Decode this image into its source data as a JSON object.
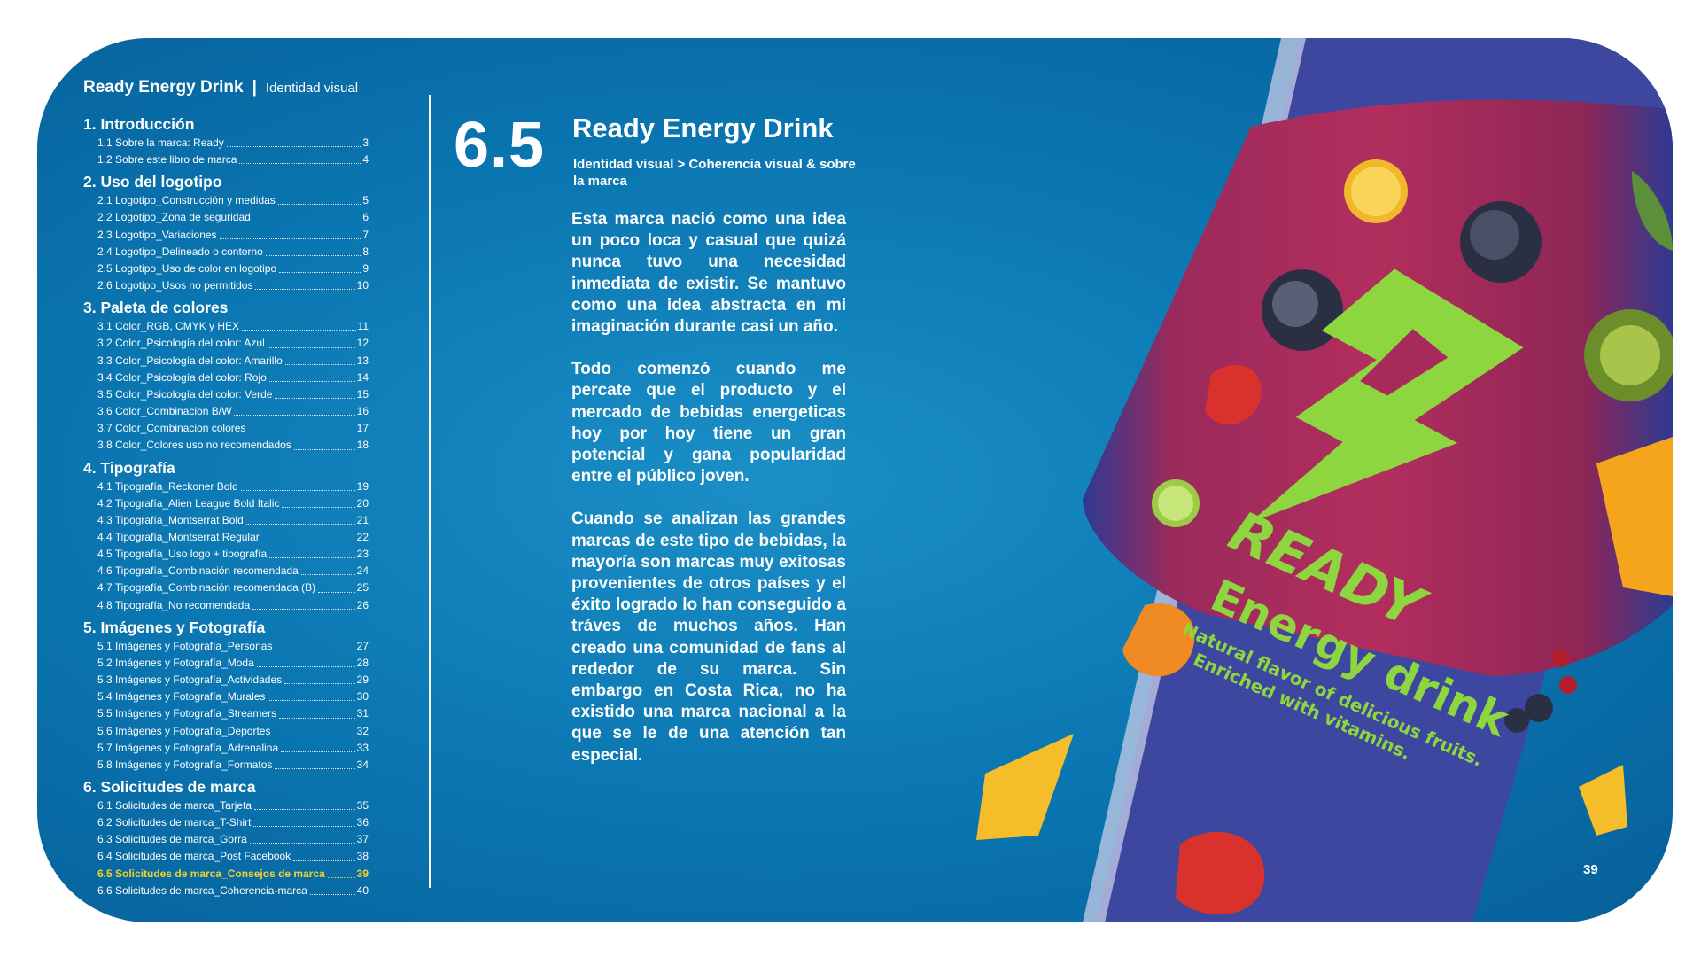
{
  "header": {
    "brand": "Ready Energy Drink",
    "separator": "|",
    "subtitle": "Identidad visual"
  },
  "toc": [
    {
      "title": "1. Introducción",
      "entries": [
        {
          "label": "1.1  Sobre la marca: Ready",
          "page": "3"
        },
        {
          "label": "1.2  Sobre este libro de marca",
          "page": "4"
        }
      ]
    },
    {
      "title": "2. Uso del logotipo",
      "entries": [
        {
          "label": "2.1  Logotipo_Construcción y medidas",
          "page": "5"
        },
        {
          "label": "2.2 Logotipo_Zona de seguridad",
          "page": "6"
        },
        {
          "label": "2.3 Logotipo_Variaciones",
          "page": "7"
        },
        {
          "label": "2.4  Logotipo_Delineado o contorno",
          "page": "8"
        },
        {
          "label": "2.5 Logotipo_Uso de color en logotipo",
          "page": "9"
        },
        {
          "label": "2.6 Logotipo_Usos no permitidos",
          "page": "10"
        }
      ]
    },
    {
      "title": "3. Paleta de colores",
      "entries": [
        {
          "label": "3.1  Color_RGB, CMYK y HEX",
          "page": "11"
        },
        {
          "label": "3.2 Color_Psicología del color: Azul",
          "page": "12"
        },
        {
          "label": "3.3 Color_Psicología del color: Amarillo",
          "page": "13"
        },
        {
          "label": "3.4 Color_Psicología del color: Rojo",
          "page": "14"
        },
        {
          "label": "3.5 Color_Psicología del color: Verde",
          "page": "15"
        },
        {
          "label": "3.6 Color_Combinacion B/W",
          "page": "16"
        },
        {
          "label": "3.7 Color_Combinacion colores",
          "page": "17"
        },
        {
          "label": "3.8 Color_Colores uso no recomendados",
          "page": "18"
        }
      ]
    },
    {
      "title": "4. Tipografía",
      "entries": [
        {
          "label": "4.1  Tipografía_Reckoner Bold",
          "page": "19"
        },
        {
          "label": "4.2 Tipografía_Alien League Bold Italic",
          "page": "20"
        },
        {
          "label": "4.3 Tipografía_Montserrat Bold",
          "page": "21"
        },
        {
          "label": "4.4 Tipografía_Montserrat Regular",
          "page": "22"
        },
        {
          "label": "4.5 Tipografía_Uso logo + tipografía",
          "page": "23"
        },
        {
          "label": "4.6 Tipografía_Combinación recomendada",
          "page": "24"
        },
        {
          "label": "4.7 Tipografía_Combinación recomendada (B)",
          "page": "25"
        },
        {
          "label": "4.8 Tipografía_No recomendada",
          "page": "26"
        }
      ]
    },
    {
      "title": "5. Imágenes y Fotografía",
      "entries": [
        {
          "label": "5.1  Imágenes y Fotografía_Personas",
          "page": "27"
        },
        {
          "label": "5.2 Imágenes y Fotografía_Moda",
          "page": "28"
        },
        {
          "label": "5.3 Imágenes y Fotografía_Actividades",
          "page": "29"
        },
        {
          "label": "5.4 Imágenes y Fotografía_Murales",
          "page": "30"
        },
        {
          "label": "5.5 Imágenes y Fotografía_Streamers",
          "page": "31"
        },
        {
          "label": "5.6 Imágenes y Fotografía_Deportes",
          "page": "32"
        },
        {
          "label": "5.7 Imágenes y Fotografía_Adrenalina",
          "page": "33"
        },
        {
          "label": "5.8 Imágenes y Fotografía_Formatos",
          "page": "34"
        }
      ]
    },
    {
      "title": "6. Solicitudes de marca",
      "entries": [
        {
          "label": "6.1  Solicitudes de marca_Tarjeta",
          "page": "35"
        },
        {
          "label": "6.2  Solicitudes de marca_T-Shirt",
          "page": "36"
        },
        {
          "label": "6.3  Solicitudes de marca_Gorra",
          "page": "37"
        },
        {
          "label": "6.4  Solicitudes de marca_Post Facebook",
          "page": "38"
        },
        {
          "label": "6.5  Solicitudes de marca_Consejos de marca",
          "page": "39",
          "active": true
        },
        {
          "label": "6.6  Solicitudes de marca_Coherencia-marca",
          "page": "40"
        }
      ]
    }
  ],
  "chapter": {
    "number": "6.5",
    "title": "Ready Energy Drink",
    "breadcrumb": "Identidad visual > Coherencia visual & sobre la marca"
  },
  "body": [
    "Esta marca nació como una idea un poco loca y casual que quizá nunca tuvo una necesidad inmediata de existir. Se mantuvo como una idea abstracta en mi imaginación durante casi un año.",
    "Todo comenzó cuando me percate que el producto y el mercado de bebidas energeticas hoy por hoy tiene un gran potencial y gana popularidad entre el público joven.",
    "Cuando se analizan las grandes marcas de este tipo de bebidas, la mayoría son marcas muy exitosas provenientes de otros países y el éxito logrado lo han conseguido a tráves de muchos años. Han creado una comunidad de fans al rededor de su marca. Sin embargo en Costa Rica, no ha existido una marca nacional a la que se le de una atención tan especial."
  ],
  "can": {
    "logo_text": "READY",
    "product": "Energy drink",
    "tagline_1": "Natural flavor of delicious fruits.",
    "tagline_2": "Enriched with vitamins.",
    "colors": {
      "can_body": "#a82a5b",
      "can_blue": "#3f4aa3",
      "accent_green": "#8ed63f",
      "highlight_yellow": "#f3d22a"
    }
  },
  "page_number": "39"
}
